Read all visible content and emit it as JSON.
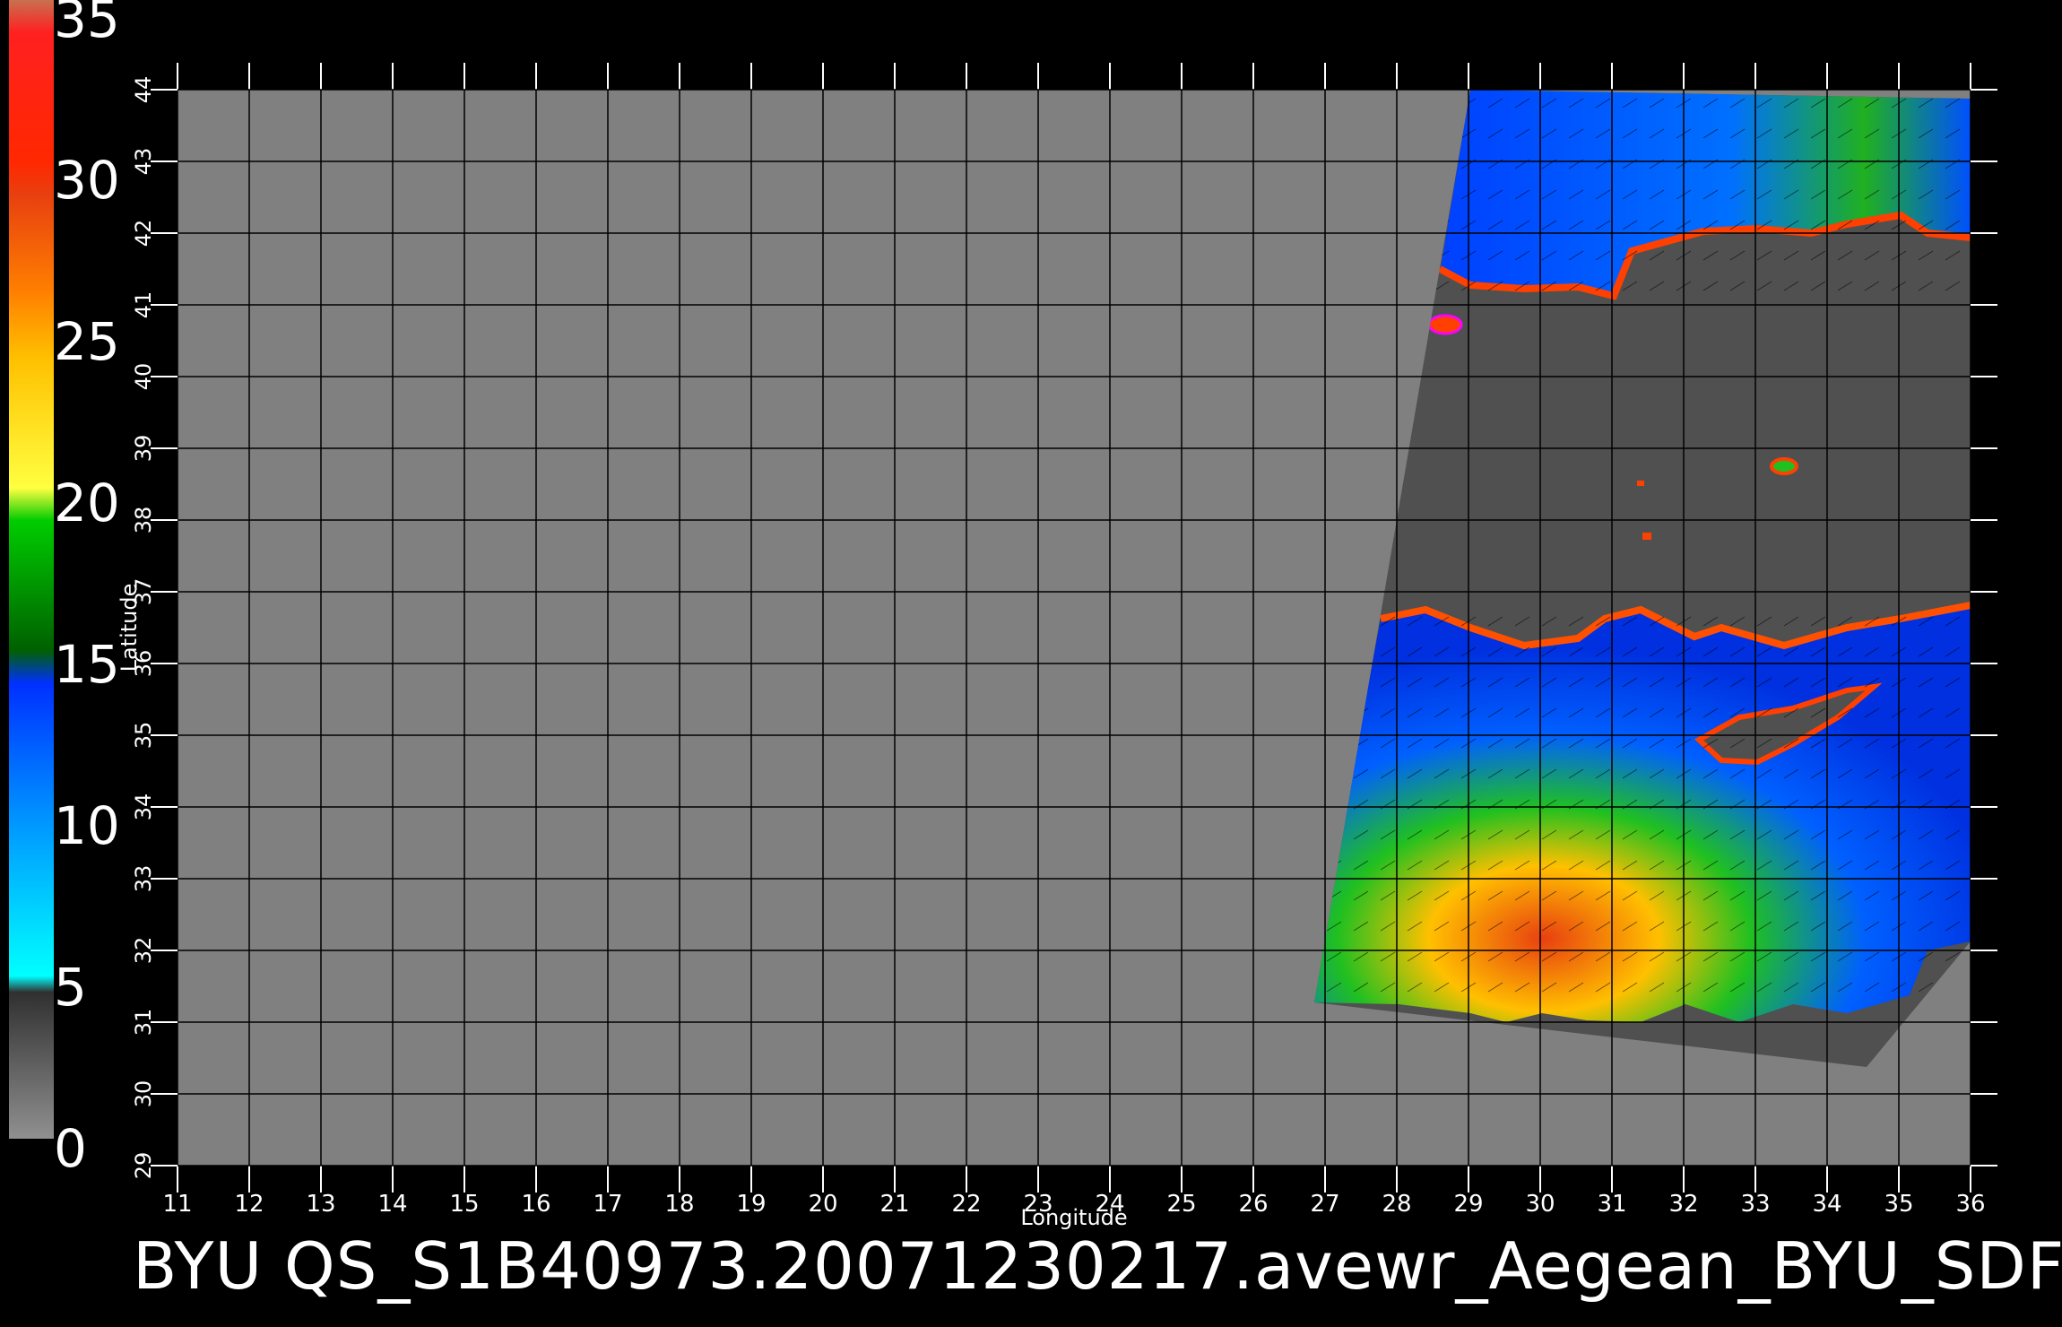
{
  "colorbar": {
    "labels": [
      "35",
      "30",
      "25",
      "20",
      "15",
      "10",
      "5",
      "0"
    ],
    "stops": [
      {
        "value": 35,
        "color": "#c87050"
      },
      {
        "value": 34,
        "color": "#ff2020"
      },
      {
        "value": 30,
        "color": "#ff2800"
      },
      {
        "value": 29,
        "color": "#e84010"
      },
      {
        "value": 26,
        "color": "#ff8000"
      },
      {
        "value": 24,
        "color": "#ffc000"
      },
      {
        "value": 20,
        "color": "#ffff40"
      },
      {
        "value": 19,
        "color": "#00cc00"
      },
      {
        "value": 15,
        "color": "#006000"
      },
      {
        "value": 14,
        "color": "#0030ff"
      },
      {
        "value": 10,
        "color": "#0090ff"
      },
      {
        "value": 5,
        "color": "#00ffff"
      },
      {
        "value": 4.5,
        "color": "#303030"
      },
      {
        "value": 0,
        "color": "#909090"
      }
    ]
  },
  "axes": {
    "xlabel": "Longitude",
    "ylabel": "Latitude",
    "lon_ticks": [
      "11",
      "12",
      "13",
      "14",
      "15",
      "16",
      "17",
      "18",
      "19",
      "20",
      "21",
      "22",
      "23",
      "24",
      "25",
      "26",
      "27",
      "28",
      "29",
      "30",
      "31",
      "32",
      "33",
      "34",
      "35",
      "36"
    ],
    "lat_ticks": [
      "29",
      "30",
      "31",
      "32",
      "33",
      "34",
      "35",
      "36",
      "37",
      "38",
      "39",
      "40",
      "41",
      "42",
      "43",
      "44"
    ],
    "lon_range": [
      11,
      36
    ],
    "lat_range": [
      29,
      44
    ]
  },
  "colors": {
    "background": "#000000",
    "ocean_nodata": "#808080",
    "land_mask": "#505050",
    "grid": "#000000"
  },
  "caption": "BYU QS_S1B40973.20071230217.avewr_Aegean_BYU_SDF"
}
